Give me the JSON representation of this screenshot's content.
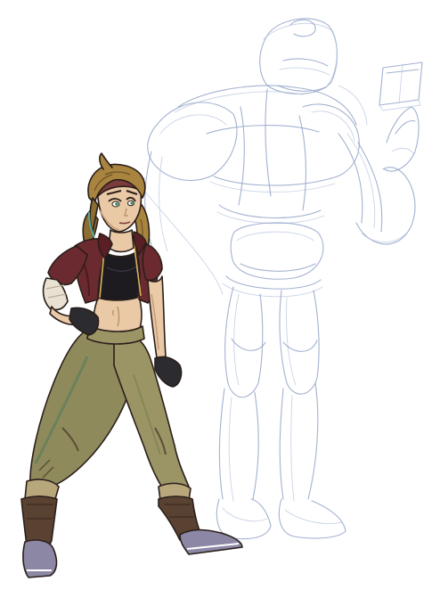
{
  "artwork": {
    "palette": {
      "background": "#ffffff",
      "sketch_line": "#93a4c8",
      "skin": "#e9c9a6",
      "skin_shadow": "#c99b76",
      "hair": "#a8843f",
      "hair_shadow": "#6e5228",
      "jacket": "#6b2a2f",
      "jacket_shadow": "#4a1a1f",
      "crop_top": "#1d1b20",
      "pants": "#8a8a5c",
      "pants_shadow": "#4f7a5c",
      "pants_highlight": "#b9a77c",
      "boots": "#5a4232",
      "shoes": "#8d87a6",
      "gloves": "#2b2b30",
      "teal_rim": "#4bc3b8",
      "bandage": "#e9e2d3"
    }
  }
}
